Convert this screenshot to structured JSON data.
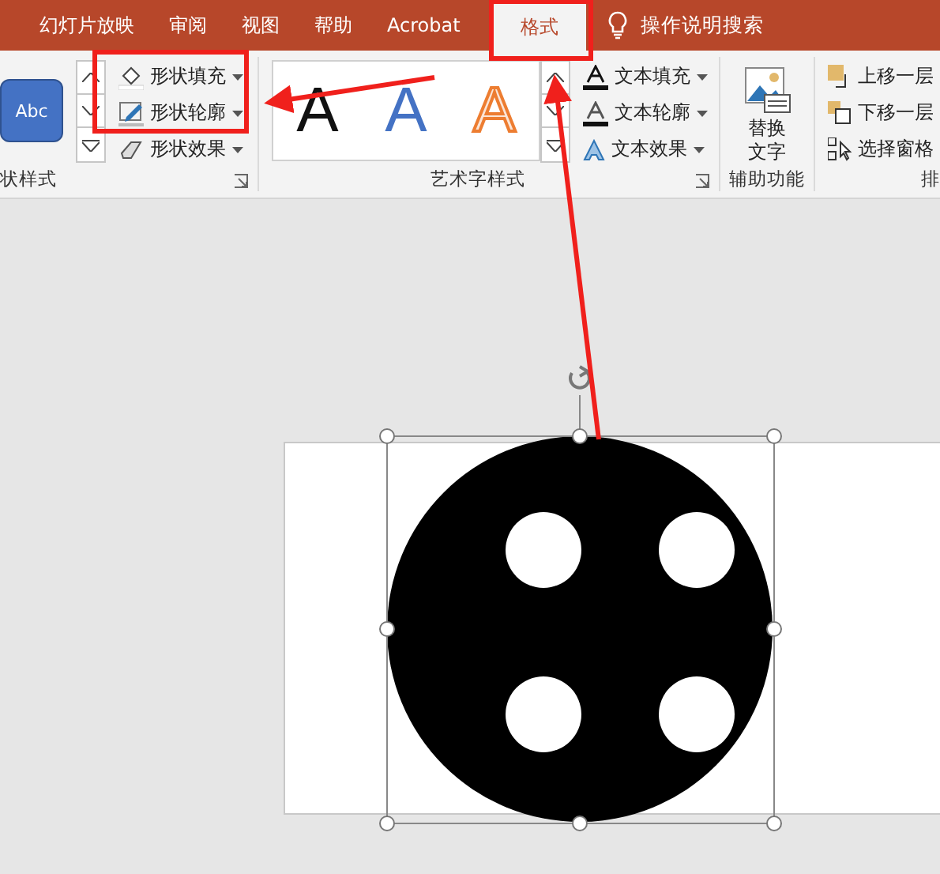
{
  "tabs": [
    {
      "label": "幻灯片放映",
      "selected": false
    },
    {
      "label": "审阅",
      "selected": false
    },
    {
      "label": "视图",
      "selected": false
    },
    {
      "label": "帮助",
      "selected": false
    },
    {
      "label": "Acrobat",
      "selected": false
    },
    {
      "label": "格式",
      "selected": true
    }
  ],
  "search": {
    "label": "操作说明搜索"
  },
  "shape_styles": {
    "label": "状样式",
    "swatch": "Abc",
    "commands": [
      {
        "label": "形状填充",
        "kind": "fill"
      },
      {
        "label": "形状轮廓",
        "kind": "outline"
      },
      {
        "label": "形状效果",
        "kind": "effect"
      }
    ]
  },
  "wordart_styles": {
    "label": "艺术字样式",
    "gallery": [
      {
        "text": "A",
        "kind": "plain"
      },
      {
        "text": "A",
        "kind": "blue"
      },
      {
        "text": "A",
        "kind": "outlined"
      }
    ],
    "commands": [
      {
        "label": "文本填充",
        "kind": "fill"
      },
      {
        "label": "文本轮廓",
        "kind": "outline"
      },
      {
        "label": "文本效果",
        "kind": "effect"
      }
    ]
  },
  "accessibility": {
    "label": "辅助功能",
    "button": "替换文字"
  },
  "arrange": {
    "label": "排",
    "commands": [
      {
        "label": "上移一层",
        "kind": "forward"
      },
      {
        "label": "下移一层",
        "kind": "backward"
      },
      {
        "label": "选择窗格",
        "kind": "pane"
      }
    ]
  }
}
